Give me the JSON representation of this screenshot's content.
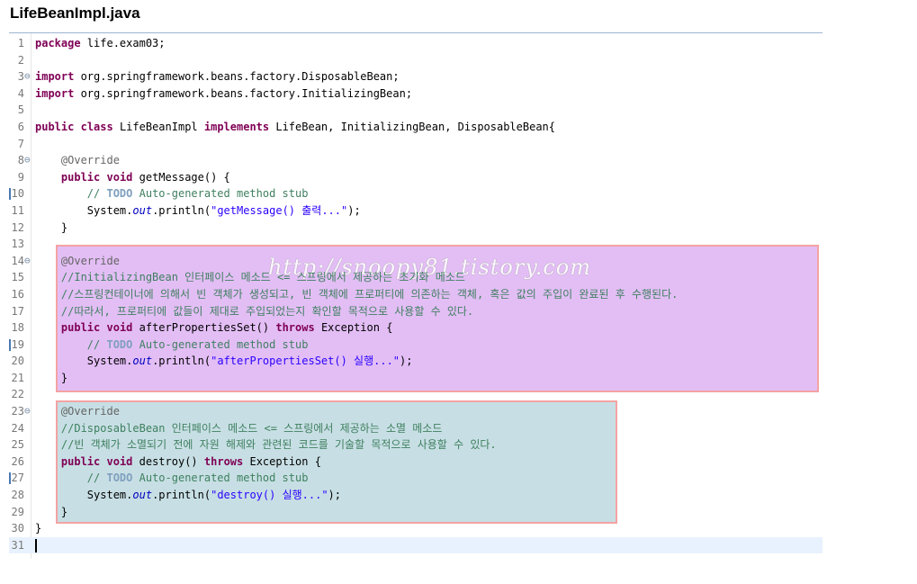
{
  "file_title": "LifeBeanImpl.java",
  "watermark": "http://snoopy81.tistory.com",
  "lines": {
    "1": {
      "no": "1",
      "t0": "package",
      "t1": " life.exam03;"
    },
    "2": {
      "no": "2"
    },
    "3": {
      "no": "3",
      "t0": "import",
      "t1": " org.springframework.beans.factory.DisposableBean;"
    },
    "4": {
      "no": "4",
      "t0": "import",
      "t1": " org.springframework.beans.factory.InitializingBean;"
    },
    "5": {
      "no": "5"
    },
    "6": {
      "no": "6",
      "t0": "public",
      "t1": " ",
      "t2": "class",
      "t3": " LifeBeanImpl ",
      "t4": "implements",
      "t5": " LifeBean, InitializingBean, DisposableBean{"
    },
    "7": {
      "no": "7"
    },
    "8": {
      "no": "8",
      "t0": "    ",
      "t1": "@Override"
    },
    "9": {
      "no": "9",
      "t0": "    ",
      "t1": "public",
      "t2": " ",
      "t3": "void",
      "t4": " getMessage() {"
    },
    "10": {
      "no": "10",
      "t0": "        // ",
      "t1": "TODO",
      "t2": " Auto-generated method stub"
    },
    "11": {
      "no": "11",
      "t0": "        System.",
      "t1": "out",
      "t2": ".println(",
      "t3": "\"getMessage() 출력...\"",
      "t4": ");"
    },
    "12": {
      "no": "12",
      "t0": "    }"
    },
    "13": {
      "no": "13"
    },
    "14": {
      "no": "14",
      "t0": "    ",
      "t1": "@Override"
    },
    "15": {
      "no": "15",
      "t0": "    ",
      "t1": "//InitializingBean 인터페이스 메소드 <= 스프링에서 제공하는 초기화 메소드"
    },
    "16": {
      "no": "16",
      "t0": "    ",
      "t1": "//스프링컨테이너에 의해서 빈 객체가 생성되고, 빈 객체에 프로퍼티에 의존하는 객체, 혹은 값의 주입이 완료된 후 수행된다."
    },
    "17": {
      "no": "17",
      "t0": "    ",
      "t1": "//따라서, 프로퍼티에 값들이 제대로 주입되었는지 확인할 목적으로 사용할 수 있다."
    },
    "18": {
      "no": "18",
      "t0": "    ",
      "t1": "public",
      "t2": " ",
      "t3": "void",
      "t4": " afterPropertiesSet() ",
      "t5": "throws",
      "t6": " Exception {"
    },
    "19": {
      "no": "19",
      "t0": "        // ",
      "t1": "TODO",
      "t2": " Auto-generated method stub"
    },
    "20": {
      "no": "20",
      "t0": "        System.",
      "t1": "out",
      "t2": ".println(",
      "t3": "\"afterPropertiesSet() 실행...\"",
      "t4": ");"
    },
    "21": {
      "no": "21",
      "t0": "    }"
    },
    "22": {
      "no": "22"
    },
    "23": {
      "no": "23",
      "t0": "    ",
      "t1": "@Override"
    },
    "24": {
      "no": "24",
      "t0": "    ",
      "t1": "//DisposableBean 인터페이스 메소드 <= 스프링에서 제공하는 소멸 메소드"
    },
    "25": {
      "no": "25",
      "t0": "    ",
      "t1": "//빈 객체가 소멸되기 전에 자원 해제와 관련된 코드를 기술할 목적으로 사용할 수 있다."
    },
    "26": {
      "no": "26",
      "t0": "    ",
      "t1": "public",
      "t2": " ",
      "t3": "void",
      "t4": " destroy() ",
      "t5": "throws",
      "t6": " Exception {"
    },
    "27": {
      "no": "27",
      "t0": "        // ",
      "t1": "TODO",
      "t2": " Auto-generated method stub"
    },
    "28": {
      "no": "28",
      "t0": "        System.",
      "t1": "out",
      "t2": ".println(",
      "t3": "\"destroy() 실행...\"",
      "t4": ");"
    },
    "29": {
      "no": "29",
      "t0": "    }"
    },
    "30": {
      "no": "30",
      "t0": "}"
    },
    "31": {
      "no": "31"
    }
  },
  "colors": {
    "keyword": "#7f0055",
    "annotation": "#646464",
    "comment": "#3f7f5f",
    "string": "#2a00ff",
    "field": "#0000c0",
    "highlight_initializing": "#e3bef5",
    "highlight_disposable": "#c7dfe4",
    "highlight_border": "#f4a3a3"
  },
  "icons": {
    "fold": "collapse-toggle-icon",
    "marker": "change-marker-icon"
  }
}
